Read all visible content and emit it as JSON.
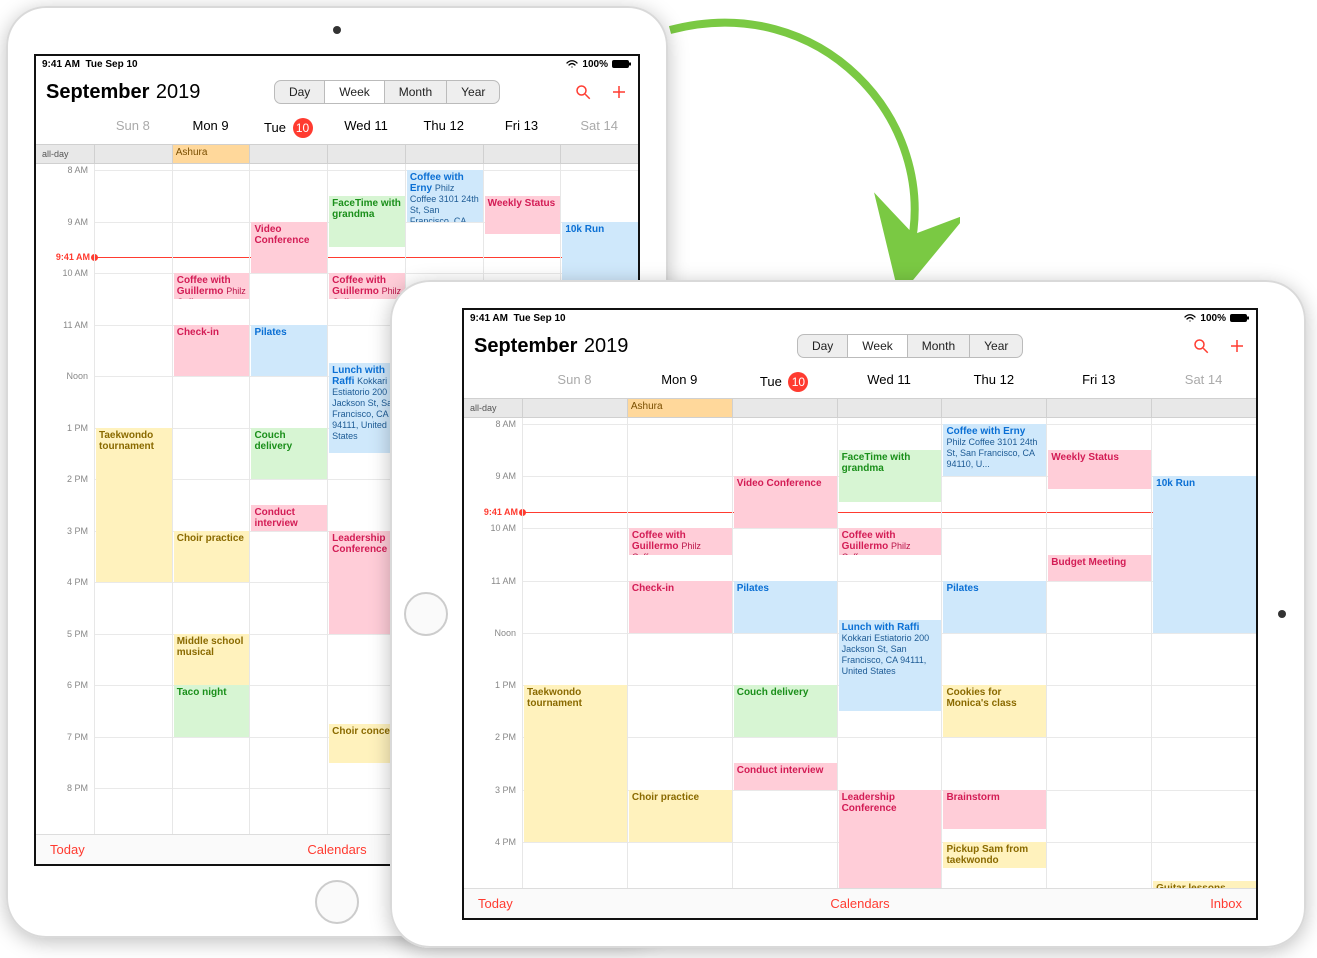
{
  "status": {
    "time": "9:41 AM",
    "date": "Tue Sep 10",
    "battery": "100%"
  },
  "header": {
    "month": "September",
    "year": "2019",
    "views": {
      "day": "Day",
      "week": "Week",
      "month": "Month",
      "year": "Year"
    }
  },
  "allday_label": "all-day",
  "days": [
    {
      "abbr": "Sun",
      "num": "8",
      "dim": true
    },
    {
      "abbr": "Mon",
      "num": "9"
    },
    {
      "abbr": "Tue",
      "num": "10",
      "today": true
    },
    {
      "abbr": "Wed",
      "num": "11"
    },
    {
      "abbr": "Thu",
      "num": "12"
    },
    {
      "abbr": "Fri",
      "num": "13"
    },
    {
      "abbr": "Sat",
      "num": "14",
      "dim": true
    }
  ],
  "hours_portrait": [
    "8 AM",
    "9 AM",
    "10 AM",
    "11 AM",
    "Noon",
    "1 PM",
    "2 PM",
    "3 PM",
    "4 PM",
    "5 PM",
    "6 PM",
    "7 PM",
    "8 PM"
  ],
  "hours_landscape": [
    "8 AM",
    "9 AM",
    "10 AM",
    "11 AM",
    "Noon",
    "1 PM",
    "2 PM",
    "3 PM",
    "4 PM"
  ],
  "now_label": "9:41 AM",
  "allday_events": [
    null,
    "Ashura",
    null,
    null,
    null,
    null,
    null
  ],
  "events": [
    {
      "day": 0,
      "start": 13,
      "end": 16,
      "color": "yellow",
      "title": "Taekwondo tournament"
    },
    {
      "day": 1,
      "start": 10,
      "end": 10.5,
      "color": "pink",
      "title": "Coffee with Guillermo",
      "sub": "Philz Coffee"
    },
    {
      "day": 1,
      "start": 11,
      "end": 12,
      "color": "pink",
      "title": "Check-in"
    },
    {
      "day": 1,
      "start": 15,
      "end": 16,
      "color": "yellow",
      "title": "Choir practice"
    },
    {
      "day": 1,
      "start": 17,
      "end": 18.5,
      "color": "yellow",
      "title": "Middle school musical"
    },
    {
      "day": 1,
      "start": 18,
      "end": 19,
      "color": "green",
      "title": "Taco night"
    },
    {
      "day": 2,
      "start": 9,
      "end": 10,
      "color": "pink",
      "title": "Video Conference"
    },
    {
      "day": 2,
      "start": 11,
      "end": 12,
      "color": "blue",
      "title": "Pilates"
    },
    {
      "day": 2,
      "start": 13,
      "end": 14,
      "color": "green",
      "title": "Couch delivery"
    },
    {
      "day": 2,
      "start": 14.5,
      "end": 15,
      "color": "pink",
      "title": "Conduct interview"
    },
    {
      "day": 3,
      "start": 8.5,
      "end": 9.5,
      "color": "green",
      "title": "FaceTime with grandma"
    },
    {
      "day": 3,
      "start": 10,
      "end": 10.5,
      "color": "pink",
      "title": "Coffee with Guillermo",
      "sub": "Philz Coffee"
    },
    {
      "day": 3,
      "start": 11.75,
      "end": 13.5,
      "color": "blue",
      "title": "Lunch with Raffi",
      "sub": "Kokkari Estiatorio 200 Jackson St, San Francisco, CA  94111, United States"
    },
    {
      "day": 3,
      "start": 15,
      "end": 17,
      "color": "pink",
      "title": "Leadership Conference"
    },
    {
      "day": 3,
      "start": 18.75,
      "end": 19.5,
      "color": "yellow",
      "title": "Choir concert"
    },
    {
      "day": 4,
      "start": 8,
      "end": 9,
      "color": "blue",
      "title": "Coffee with Erny",
      "sub": "Philz Coffee 3101 24th St, San Francisco, CA  94110, U..."
    },
    {
      "day": 4,
      "start": 11,
      "end": 12,
      "color": "blue",
      "title": "Pilates"
    },
    {
      "day": 4,
      "start": 13,
      "end": 14,
      "color": "yellow",
      "title": "Cookies for Monica's class"
    },
    {
      "day": 4,
      "start": 15,
      "end": 15.75,
      "color": "pink",
      "title": "Brainstorm"
    },
    {
      "day": 4,
      "start": 16,
      "end": 16.5,
      "color": "yellow",
      "title": "Pickup Sam from taekwondo"
    },
    {
      "day": 5,
      "start": 8.5,
      "end": 9.25,
      "color": "pink",
      "title": "Weekly Status"
    },
    {
      "day": 5,
      "start": 10.5,
      "end": 11,
      "color": "pink",
      "title": "Budget Meeting"
    },
    {
      "day": 6,
      "start": 9,
      "end": 12,
      "color": "blue",
      "title": "10k Run"
    },
    {
      "day": 6,
      "start": 16.75,
      "end": 17.25,
      "color": "yellow",
      "title": "Guitar lessons"
    }
  ],
  "bottom": {
    "today": "Today",
    "calendars": "Calendars",
    "inbox": "Inbox"
  }
}
